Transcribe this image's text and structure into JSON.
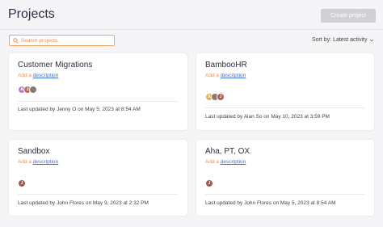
{
  "header": {
    "title": "Projects",
    "create_button": "Create project"
  },
  "toolbar": {
    "search_placeholder": "Search projects",
    "sort_label": "Sort by: Latest activity"
  },
  "colors": {
    "accent": "#f08b4a",
    "link": "#3f6fd6",
    "disabled_button": "#cfd1d6"
  },
  "projects": [
    {
      "title": "Customer Migrations",
      "desc_add": "Add a",
      "desc_link": "description",
      "avatars": [
        {
          "initial": "A",
          "color": "#b57bd1"
        },
        {
          "initial": "J",
          "color": "#c06a5a"
        },
        {
          "initial": "",
          "color": "#8a7a6a"
        }
      ],
      "updated": "Last updated by Jenny O on May 5, 2023 at 8:54 AM"
    },
    {
      "title": "BambooHR",
      "desc_add": "Add a",
      "desc_link": "description",
      "avatars": [
        {
          "initial": "A",
          "color": "#e0b15a"
        },
        {
          "initial": "",
          "color": "#8a7a6a"
        },
        {
          "initial": "J",
          "color": "#b0604f"
        }
      ],
      "updated": "Last updated by Alan So on May 10, 2023 at 3:59 PM"
    },
    {
      "title": "Sandbox",
      "desc_add": "Add a",
      "desc_link": "description",
      "avatars": [
        {
          "initial": "J",
          "color": "#9a5b4e"
        }
      ],
      "updated": "Last updated by John Flores on May 9, 2023 at 2:32 PM"
    },
    {
      "title": "Aha, PT, OX",
      "desc_add": "Add a",
      "desc_link": "description",
      "avatars": [
        {
          "initial": "J",
          "color": "#9a5b4e"
        }
      ],
      "updated": "Last updated by John Flores on May 5, 2023 at 8:54 AM"
    }
  ]
}
